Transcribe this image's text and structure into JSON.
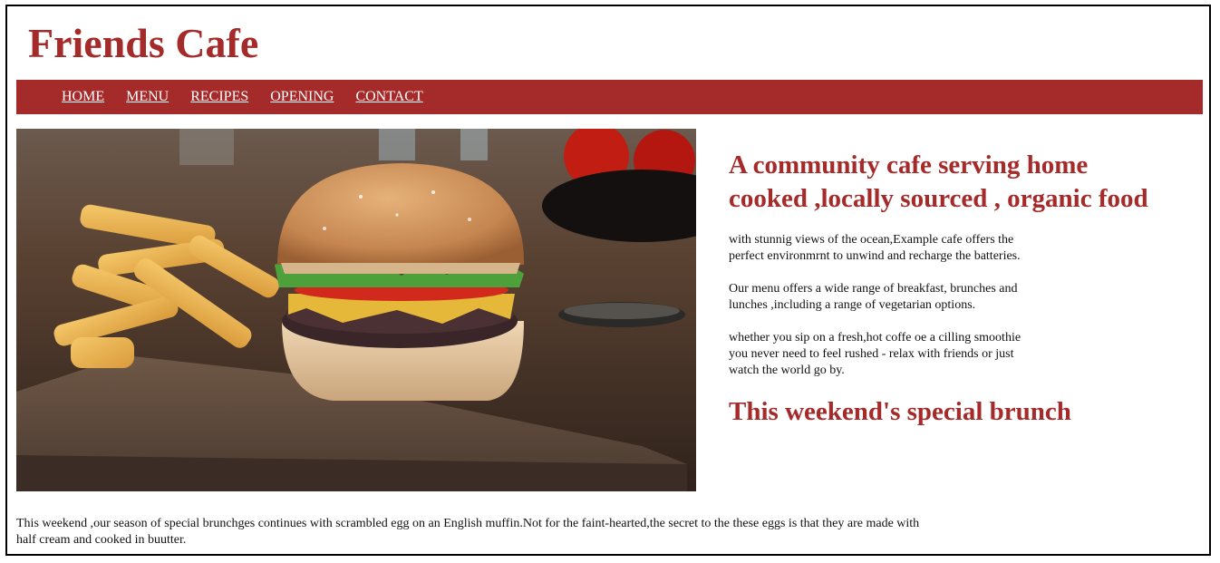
{
  "site": {
    "title": "Friends Cafe"
  },
  "nav": {
    "items": [
      {
        "label": "HOME"
      },
      {
        "label": "MENU"
      },
      {
        "label": "RECIPES"
      },
      {
        "label": "OPENING"
      },
      {
        "label": "CONTACT"
      }
    ]
  },
  "main": {
    "heading": "A community cafe serving home cooked ,locally sourced , organic food",
    "paragraphs": [
      "with stunnig views of the ocean,Example cafe offers the perfect environmrnt to unwind and recharge the batteries.",
      "Our menu offers a wide range of breakfast, brunches and lunches ,including a range of vegetarian options.",
      "whether you sip on a fresh,hot coffe oe a cilling smoothie you never need to feel rushed - relax with friends or just watch the world go by."
    ],
    "special_heading": "This weekend's special brunch",
    "special_text": "This weekend ,our season of special brunchges continues with scrambled egg on an English muffin.Not for the faint-hearted,the secret to the these eggs is that they are made with half cream and cooked in buutter."
  },
  "colors": {
    "brand": "#a52a2a",
    "nav_text": "#ffffff"
  },
  "hero_image": {
    "icon": "burger-and-fries-photo"
  }
}
